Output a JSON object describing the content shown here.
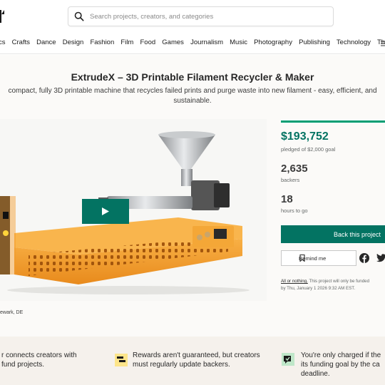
{
  "search": {
    "placeholder": "Search projects, creators, and categories"
  },
  "categories": [
    "cs",
    "Crafts",
    "Dance",
    "Design",
    "Fashion",
    "Film",
    "Food",
    "Games",
    "Journalism",
    "Music",
    "Photography",
    "Publishing",
    "Technology",
    "Theater"
  ],
  "project": {
    "title": "ExtrudeX – 3D Printable Filament Recycler & Maker",
    "blurb_line1": "compact, fully 3D printable machine that recycles failed prints and purge waste into new filament - easy, efficient, and",
    "blurb_line2": "sustainable.",
    "location": "ewark, DE"
  },
  "stats": {
    "pledged": "$193,752",
    "goal_text": "pledged of $2,000 goal",
    "backers": "2,635",
    "backers_label": "backers",
    "days": "18",
    "days_label": "hours to go",
    "progress_fraction": 1.0
  },
  "actions": {
    "back_label": "Back this project",
    "remind_label": "Remind me"
  },
  "fine_print": {
    "aon_link": "All or nothing.",
    "aon_text": " This project will only be funded",
    "aon_line2": "by Thu, January 1 2026 9:32 AM EST."
  },
  "info_strip": {
    "item1_line1": "r connects creators with",
    "item1_line2": "fund projects.",
    "item2_line1": "Rewards aren't guaranteed, but creators",
    "item2_line2": "must regularly update backers.",
    "item3_line1": "You're only charged if the",
    "item3_line2": "its funding goal by the ca",
    "item3_line3": "deadline."
  },
  "colors": {
    "brand": "#037362",
    "progress": "#009e74",
    "machine": "#f5a030"
  },
  "icons": [
    "search-icon",
    "play-icon",
    "bookmark-icon",
    "facebook-icon",
    "twitter-icon",
    "menu-icon"
  ]
}
